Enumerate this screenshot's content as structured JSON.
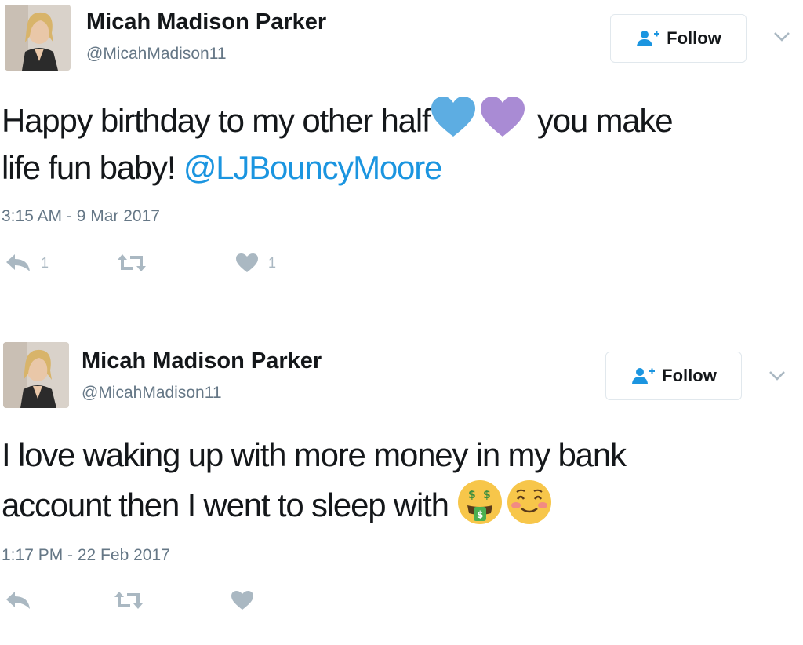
{
  "tweets": [
    {
      "author_name": "Micah Madison Parker",
      "handle": "@MicahMadison11",
      "follow_label": "Follow",
      "text_line1_a": "Happy birthday to my other half",
      "text_line1_b": " you make",
      "text_line2_a": "life fun baby! ",
      "mention": "@LJBouncyMoore",
      "emojis": [
        "blue-heart",
        "purple-heart"
      ],
      "timestamp": "3:15 AM - 9 Mar 2017",
      "reply_count": "1",
      "like_count": "1"
    },
    {
      "author_name": "Micah Madison Parker",
      "handle": "@MicahMadison11",
      "follow_label": "Follow",
      "text_line1": "I love waking up with more money in my bank",
      "text_line2": "account then I went to sleep with ",
      "emojis": [
        "money-mouth-face",
        "smiling-face"
      ],
      "timestamp": "1:17 PM - 22 Feb 2017"
    }
  ],
  "colors": {
    "mention": "#1b95e0",
    "secondary_text": "#657786",
    "action_icons": "#aab8c2",
    "blue_heart": "#5dade2",
    "purple_heart": "#a98bd4"
  }
}
